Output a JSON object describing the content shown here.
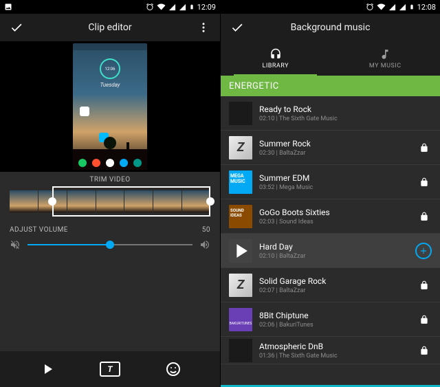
{
  "status": {
    "time_left": "12:09",
    "time_right": "12:08"
  },
  "left": {
    "appbar_title": "Clip editor",
    "preview": {
      "clock": "12:06",
      "day": "Tuesday"
    },
    "trim_label": "TRIM VIDEO",
    "volume_label": "ADJUST VOLUME",
    "volume_value": "50",
    "volume_percent": 50
  },
  "right": {
    "appbar_title": "Background music",
    "tabs": {
      "library": "LIBRARY",
      "mymusic": "MY MUSIC"
    },
    "category": "ENERGETIC",
    "tracks": [
      {
        "title": "Ready to Rock",
        "meta": "02:10 | The Sixth Gate Music",
        "locked": false,
        "selected": false,
        "art": "band"
      },
      {
        "title": "Summer Rock",
        "meta": "02:30 | BaltaZzar",
        "locked": true,
        "selected": false,
        "art": "z"
      },
      {
        "title": "Summer EDM",
        "meta": "03:52 | Mega Music",
        "locked": true,
        "selected": false,
        "art": "mega"
      },
      {
        "title": "GoGo Boots Sixties",
        "meta": "02:03 | Sound Ideas",
        "locked": true,
        "selected": false,
        "art": "sound"
      },
      {
        "title": "Hard Day",
        "meta": "02:10 | BaltaZzar",
        "locked": false,
        "selected": true,
        "art": "play"
      },
      {
        "title": "Solid Garage Rock",
        "meta": "02:07 | BaltaZzar",
        "locked": true,
        "selected": false,
        "art": "z"
      },
      {
        "title": "8Bit Chiptune",
        "meta": "02:06 | BakuriTunes",
        "locked": true,
        "selected": false,
        "art": "bakuri"
      },
      {
        "title": "Atmospheric DnB",
        "meta": "01:36 | The Sixth Gate Music",
        "locked": true,
        "selected": false,
        "art": "band"
      }
    ]
  }
}
